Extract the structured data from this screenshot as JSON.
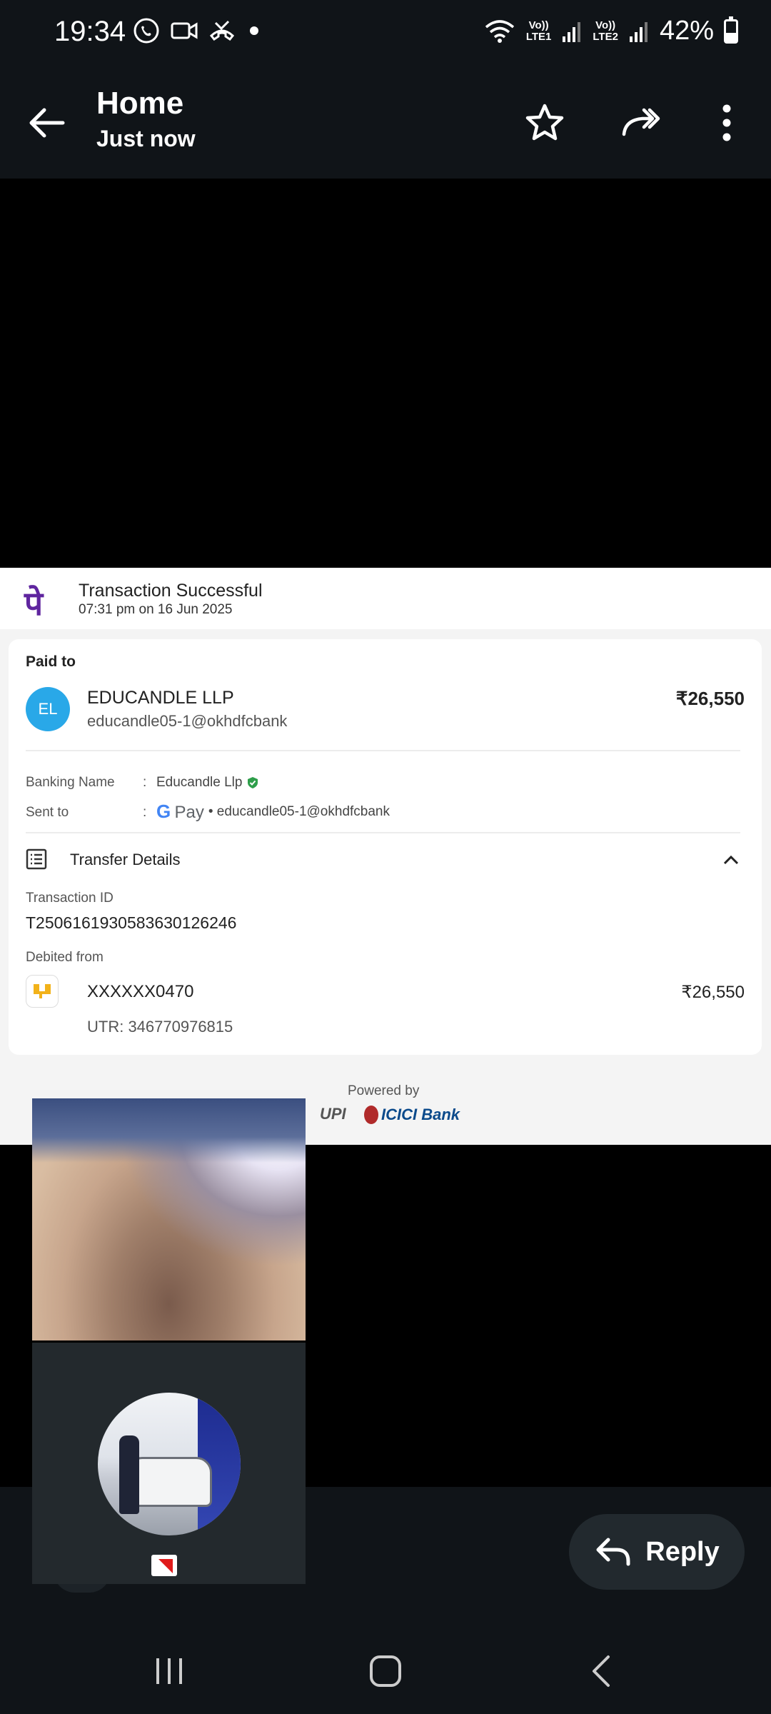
{
  "status_bar": {
    "time": "19:34",
    "network_1_top": "Vo))",
    "network_1_bottom": "LTE1",
    "network_2_top": "Vo))",
    "network_2_bottom": "LTE2",
    "battery_percent": "42%",
    "battery_level": 0.42
  },
  "app_bar": {
    "title": "Home",
    "subtitle": "Just now"
  },
  "receipt": {
    "header_title": "Transaction Successful",
    "header_date": "07:31 pm on 16 Jun 2025",
    "paid_to_label": "Paid to",
    "avatar_initials": "EL",
    "payee_name": "EDUCANDLE LLP",
    "payee_vpa": "educandle05-1@okhdfcbank",
    "amount": "₹26,550",
    "banking_name_label": "Banking Name",
    "banking_name_value": "Educandle Llp",
    "sent_to_label": "Sent to",
    "sent_to_app_g": "G",
    "sent_to_app_pay": "Pay",
    "sent_to_value": "• educandle05-1@okhdfcbank",
    "colon": ":",
    "transfer_details_label": "Transfer Details",
    "transaction_id_label": "Transaction ID",
    "transaction_id": "T2506161930583630126246",
    "debited_from_label": "Debited from",
    "account": "XXXXXX0470",
    "debit_amount": "₹26,550",
    "utr": "UTR: 346770976815",
    "powered_by": "Powered by",
    "upi_text": "UPI",
    "icici_text": "ICICI Bank"
  },
  "reply": {
    "label": "Reply"
  },
  "colors": {
    "phonepe_purple": "#5f259f",
    "avatar_blue": "#29a8e8",
    "verified_green": "#2e9e4a",
    "bar_dark": "#101418"
  },
  "icons": [
    "back-arrow-icon",
    "star-icon",
    "forward-icon",
    "more-vert-icon",
    "verified-icon",
    "list-icon",
    "chevron-up-icon",
    "reply-icon",
    "recents-icon",
    "home-icon",
    "nav-back-icon"
  ]
}
